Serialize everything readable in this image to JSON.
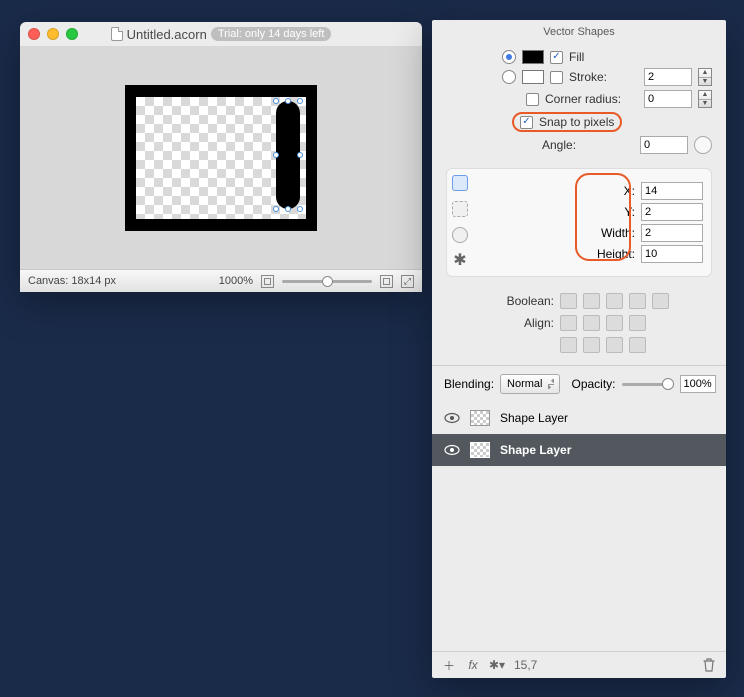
{
  "window": {
    "document_name": "Untitled.acorn",
    "trial_label": "Trial: only 14 days left",
    "canvas_label": "Canvas: 18x14 px",
    "zoom_label": "1000%"
  },
  "panel": {
    "title": "Vector Shapes",
    "fill_label": "Fill",
    "stroke_label": "Stroke:",
    "stroke_value": "2",
    "corner_label": "Corner radius:",
    "corner_value": "0",
    "snap_label": "Snap to pixels",
    "angle_label": "Angle:",
    "angle_value": "0",
    "geom": {
      "x_label": "X:",
      "y_label": "Y:",
      "w_label": "Width:",
      "h_label": "Height:",
      "x": "14",
      "y": "2",
      "width": "2",
      "height": "10"
    },
    "boolean_label": "Boolean:",
    "align_label": "Align:",
    "blending_label": "Blending:",
    "blending_value": "Normal",
    "opacity_label": "Opacity:",
    "opacity_value": "100%",
    "layers": [
      {
        "name": "Shape Layer",
        "selected": false
      },
      {
        "name": "Shape Layer",
        "selected": true
      }
    ],
    "footer_coords": "15,7"
  }
}
